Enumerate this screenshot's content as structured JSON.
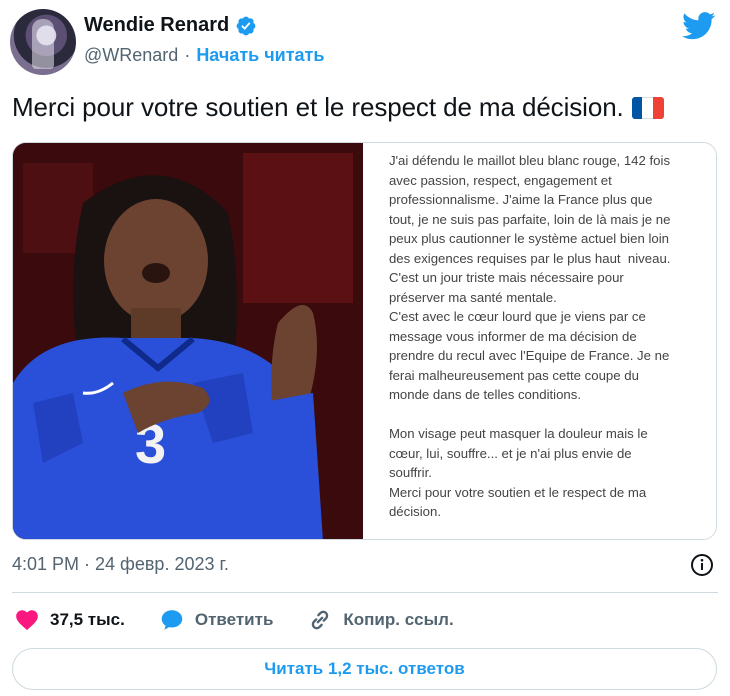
{
  "author": {
    "display_name": "Wendie Renard",
    "handle": "@WRenard",
    "follow_label": "Начать читать",
    "verified_color": "#1d9bf0"
  },
  "tweet": {
    "text": "Merci pour votre soutien et le respect de ma décision.",
    "flag_colors": [
      "#0055a4",
      "#ffffff",
      "#ef4135"
    ]
  },
  "media": {
    "statement_text": "J'ai défendu le maillot bleu blanc rouge, 142 fois\navec passion, respect, engagement et\nprofessionnalisme. J'aime la France plus que\ntout, je ne suis pas parfaite, loin de là mais je ne\npeux plus cautionner le système actuel bien loin\ndes exigences requises par le plus haut  niveau.\nC'est un jour triste mais nécessaire pour\npréserver ma santé mentale.\nC'est avec le cœur lourd que je viens par ce\nmessage vous informer de ma décision de\nprendre du recul avec l'Equipe de France. Je ne\nferai malheureusement pas cette coupe du\nmonde dans de telles conditions.\n\nMon visage peut masquer la douleur mais le\ncœur, lui, souffre... et je n'ai plus envie de\nsouffrir.\nMerci pour votre soutien et le respect de ma\ndécision.",
    "jersey_number": "3"
  },
  "timestamp": "4:01 PM · 24 февр. 2023 г.",
  "actions": {
    "like_count": "37,5 тыс.",
    "reply_label": "Ответить",
    "copy_link_label": "Копир. ссыл."
  },
  "read_replies_label": "Читать 1,2 тыс. ответов",
  "colors": {
    "accent": "#1d9bf0",
    "like": "#f91880",
    "text": "#0f1419",
    "secondary": "#536471"
  }
}
